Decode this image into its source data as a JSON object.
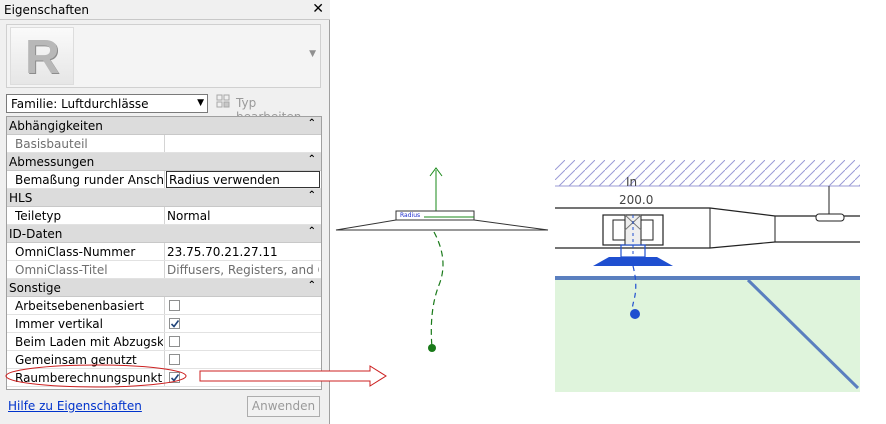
{
  "palette": {
    "title": "Eigenschaften",
    "type_selector": {
      "value": "Familie: Luftdurchlässe"
    },
    "edit_type_label": "Typ bearbeiten",
    "categories": {
      "constraints": "Abhängigkeiten",
      "dimensions": "Abmessungen",
      "hvac": "HLS",
      "identity": "ID-Daten",
      "other": "Sonstige"
    },
    "rows": {
      "host": {
        "name": "Basisbauteil",
        "value": ""
      },
      "round_dim": {
        "name": "Bemaßung runder Anschl...",
        "value": "Radius verwenden"
      },
      "part_type": {
        "name": "Teiletyp",
        "value": "Normal"
      },
      "omniclass_number": {
        "name": "OmniClass-Nummer",
        "value": "23.75.70.21.27.11"
      },
      "omniclass_title": {
        "name": "OmniClass-Titel",
        "value": "Diffusers, Registers, and Gri..."
      },
      "workplane_based": {
        "name": "Arbeitsebenenbasiert",
        "checked": false
      },
      "always_vertical": {
        "name": "Immer vertikal",
        "checked": true
      },
      "cut_voids": {
        "name": "Beim Laden mit Abzugskö...",
        "checked": false
      },
      "shared": {
        "name": "Gemeinsam genutzt",
        "checked": false
      },
      "room_calc_point": {
        "name": "Raumberechnungspunkt",
        "checked": true
      }
    },
    "help_link": "Hilfe zu Eigenschaften",
    "apply_button": "Anwenden"
  },
  "family_view": {
    "label": "Radius"
  },
  "project_view": {
    "label_in": "In",
    "dimension": "200.0"
  },
  "icons": {
    "logo": "revit-logo",
    "close": "close-icon",
    "dropdown": "chevron-down-icon",
    "collapse": "double-chevron-up-icon",
    "edit_type": "edit-type-icon",
    "check": "checkmark-icon",
    "arrow": "annotation-arrow"
  },
  "colors": {
    "annotation_red": "#cc2020",
    "link_blue": "#0033cc",
    "room_point_green": "#1a7a1a",
    "selected_blue": "#1f4fd0",
    "room_fill": "#dff4dc"
  }
}
